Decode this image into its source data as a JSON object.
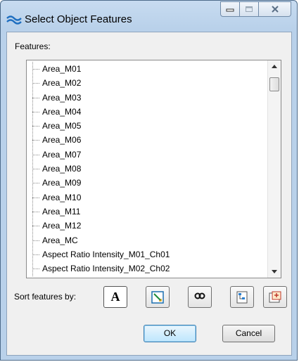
{
  "window": {
    "title": "Select Object Features",
    "icon": "wave-app-icon",
    "controls": [
      "minimize-icon",
      "maximize-icon",
      "close-icon"
    ]
  },
  "features": {
    "label": "Features:",
    "items": [
      "Area_M01",
      "Area_M02",
      "Area_M03",
      "Area_M04",
      "Area_M05",
      "Area_M06",
      "Area_M07",
      "Area_M08",
      "Area_M09",
      "Area_M10",
      "Area_M11",
      "Area_M12",
      "Area_MC",
      "Aspect Ratio Intensity_M01_Ch01",
      "Aspect Ratio Intensity_M02_Ch02"
    ]
  },
  "sort": {
    "label": "Sort features by:",
    "buttons": [
      {
        "name": "sort-alphabetical-icon",
        "glyph": "A"
      },
      {
        "name": "sort-image-icon"
      },
      {
        "name": "sort-link-icon"
      },
      {
        "name": "sort-category-icon"
      },
      {
        "name": "sort-tabs-icon"
      }
    ]
  },
  "actions": {
    "ok": "OK",
    "cancel": "Cancel"
  },
  "colors": {
    "accent": "#3c7fb1",
    "frame": "#b9d1ea",
    "client": "#f0f0f0"
  }
}
